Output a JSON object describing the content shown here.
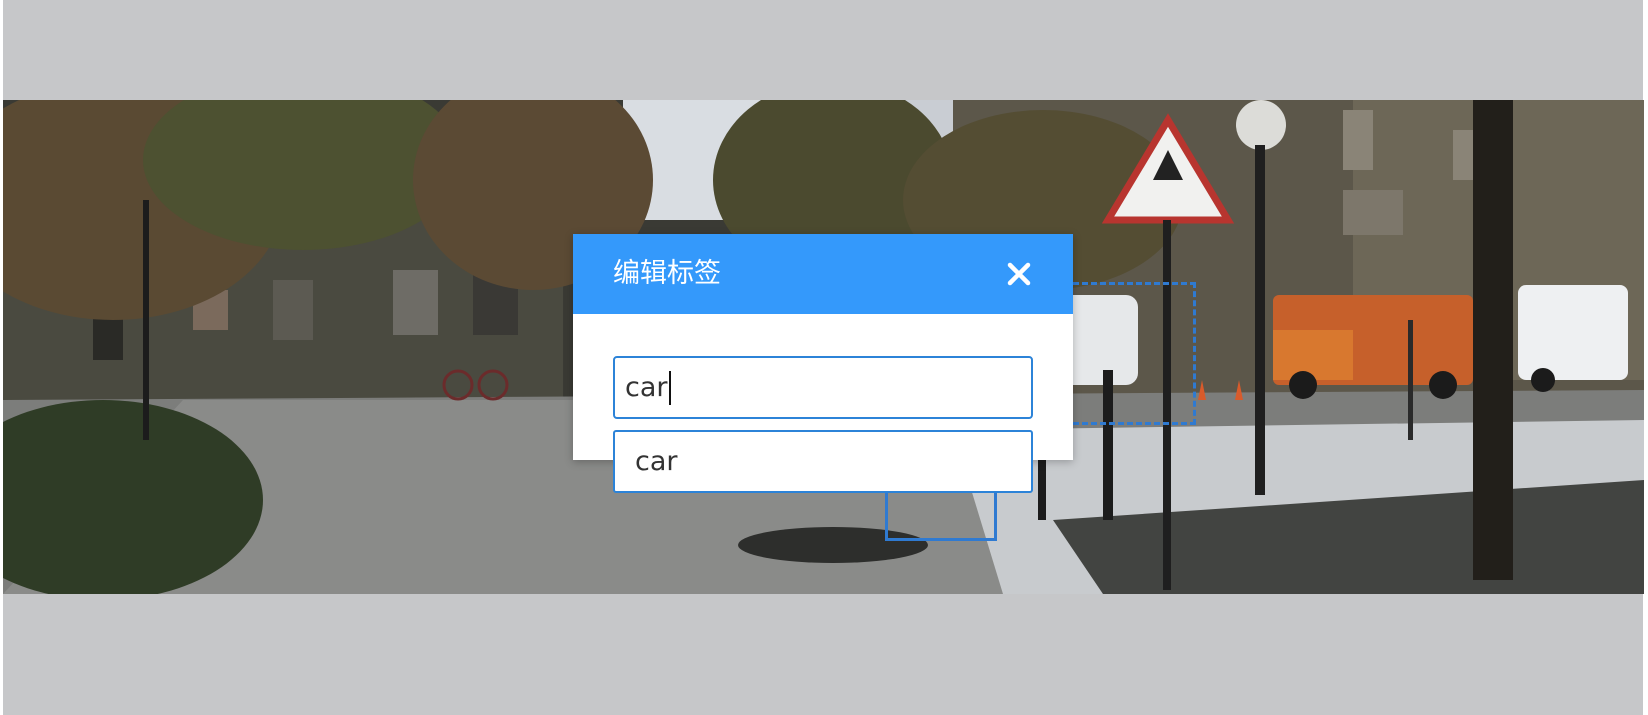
{
  "dialog": {
    "title": "编辑标签",
    "close_icon": "close-icon",
    "input_value": "car"
  },
  "suggestions": [
    "car"
  ],
  "colors": {
    "header": "#3499fb",
    "input_border": "#2c83d8",
    "bbox": "#2f7ad1",
    "background": "#c6c7c9"
  }
}
